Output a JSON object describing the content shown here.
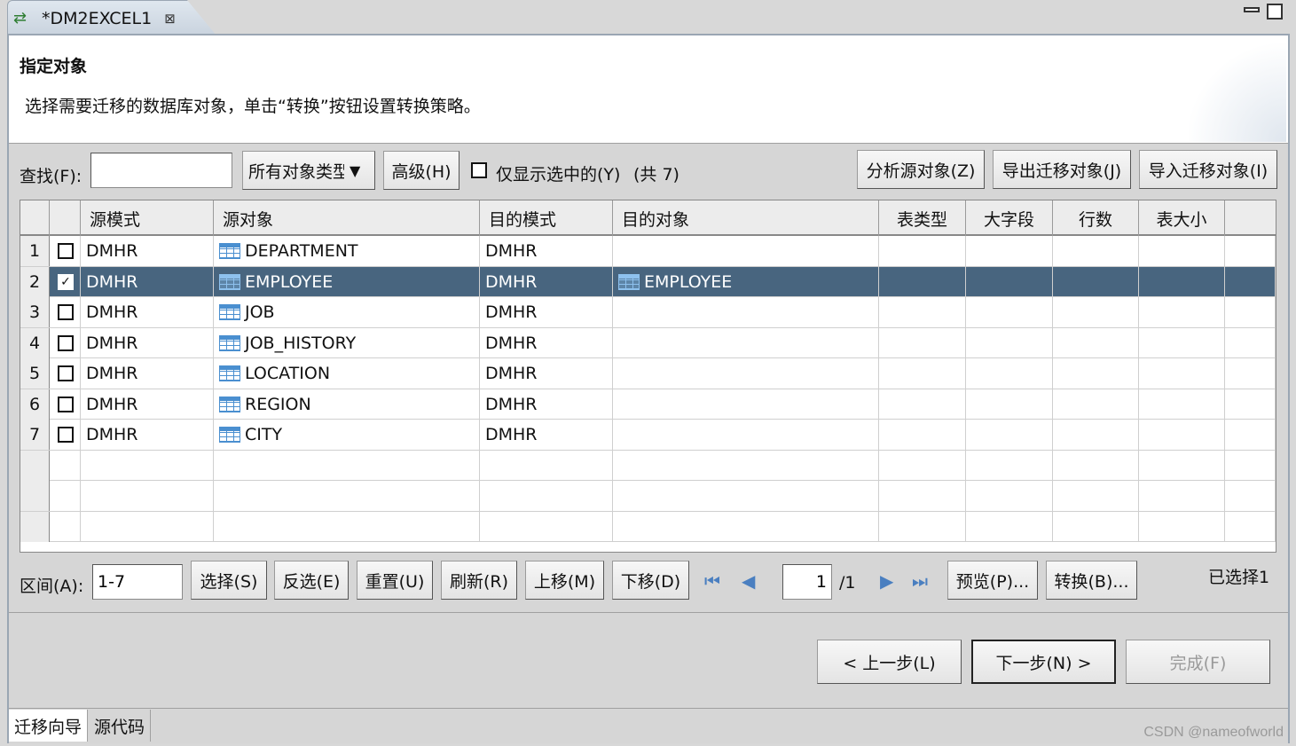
{
  "editor_tab": {
    "title": "*DM2EXCEL1",
    "close": "⊠"
  },
  "header": {
    "title": "指定对象",
    "description": "选择需要迁移的数据库对象，单击“转换”按钮设置转换策略。"
  },
  "toolbar": {
    "find_label": "查找(F):",
    "find_value": "",
    "object_type": "所有对象类型",
    "advanced": "高级(H)",
    "only_selected": "仅显示选中的(Y)",
    "count": "(共 7)",
    "analyze": "分析源对象(Z)",
    "export": "导出迁移对象(J)",
    "import": "导入迁移对象(I)"
  },
  "grid": {
    "columns": [
      "源模式",
      "源对象",
      "目的模式",
      "目的对象",
      "表类型",
      "大字段",
      "行数",
      "表大小"
    ],
    "rows": [
      {
        "num": "1",
        "checked": false,
        "src_schema": "DMHR",
        "src_object": "DEPARTMENT",
        "dst_schema": "DMHR",
        "dst_object": ""
      },
      {
        "num": "2",
        "checked": true,
        "src_schema": "DMHR",
        "src_object": "EMPLOYEE",
        "dst_schema": "DMHR",
        "dst_object": "EMPLOYEE"
      },
      {
        "num": "3",
        "checked": false,
        "src_schema": "DMHR",
        "src_object": "JOB",
        "dst_schema": "DMHR",
        "dst_object": ""
      },
      {
        "num": "4",
        "checked": false,
        "src_schema": "DMHR",
        "src_object": "JOB_HISTORY",
        "dst_schema": "DMHR",
        "dst_object": ""
      },
      {
        "num": "5",
        "checked": false,
        "src_schema": "DMHR",
        "src_object": "LOCATION",
        "dst_schema": "DMHR",
        "dst_object": ""
      },
      {
        "num": "6",
        "checked": false,
        "src_schema": "DMHR",
        "src_object": "REGION",
        "dst_schema": "DMHR",
        "dst_object": ""
      },
      {
        "num": "7",
        "checked": false,
        "src_schema": "DMHR",
        "src_object": "CITY",
        "dst_schema": "DMHR",
        "dst_object": ""
      }
    ]
  },
  "bottom_bar": {
    "range_label": "区间(A):",
    "range_value": "1-7",
    "select": "选择(S)",
    "invert": "反选(E)",
    "reset": "重置(U)",
    "refresh": "刷新(R)",
    "move_up": "上移(M)",
    "move_down": "下移(D)",
    "page_value": "1",
    "page_total": "/1",
    "preview": "预览(P)...",
    "convert": "转换(B)...",
    "selected_count": "已选择1"
  },
  "wizard": {
    "back": "< 上一步(L)",
    "next": "下一步(N) >",
    "finish": "完成(F)"
  },
  "bottom_tabs": [
    "迁移向导",
    "源代码"
  ],
  "watermark": "CSDN @nameofworld",
  "colors": {
    "selected_row": "#48657f",
    "table_icon": "#4a8fd0"
  }
}
